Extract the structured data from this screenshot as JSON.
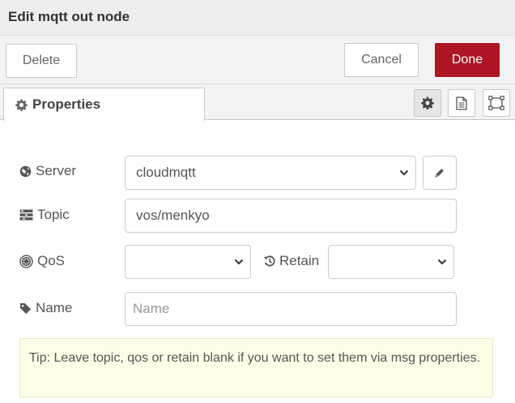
{
  "dialog": {
    "title": "Edit mqtt out node"
  },
  "actions": {
    "delete_label": "Delete",
    "cancel_label": "Cancel",
    "done_label": "Done"
  },
  "tabs": {
    "properties_label": "Properties"
  },
  "tab_icons": [
    "gear-icon",
    "document-icon",
    "frame-icon"
  ],
  "form": {
    "server": {
      "label": "Server",
      "value": "cloudmqtt"
    },
    "topic": {
      "label": "Topic",
      "value": "vos/menkyo"
    },
    "qos": {
      "label": "QoS",
      "value": ""
    },
    "retain": {
      "label": "Retain",
      "value": ""
    },
    "name": {
      "label": "Name",
      "value": "",
      "placeholder": "Name"
    }
  },
  "tip": {
    "text": "Tip: Leave topic, qos or retain blank if you want to set them via msg properties."
  },
  "colors": {
    "done_button": "#ad1625",
    "tip_background": "#fefee8",
    "header_background": "#eeeeee"
  }
}
